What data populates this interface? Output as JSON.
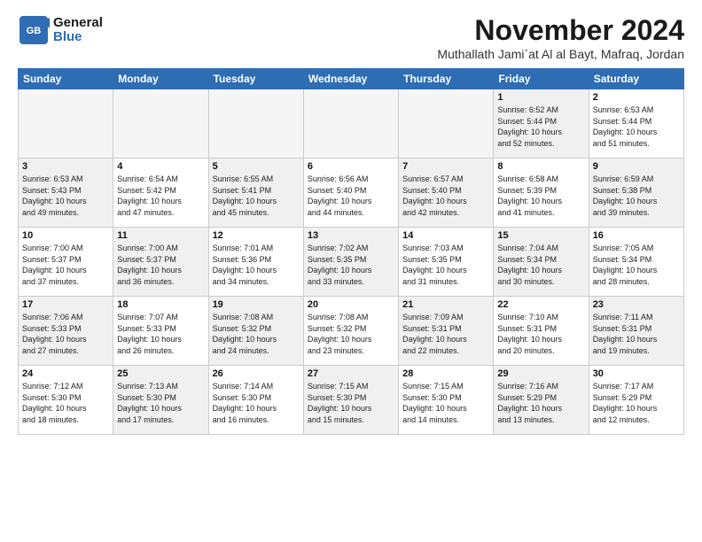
{
  "header": {
    "logo_line1": "General",
    "logo_line2": "Blue",
    "month": "November 2024",
    "location": "Muthallath Jami`at Al al Bayt, Mafraq, Jordan"
  },
  "days_of_week": [
    "Sunday",
    "Monday",
    "Tuesday",
    "Wednesday",
    "Thursday",
    "Friday",
    "Saturday"
  ],
  "weeks": [
    [
      {
        "day": "",
        "info": "",
        "empty": true
      },
      {
        "day": "",
        "info": "",
        "empty": true
      },
      {
        "day": "",
        "info": "",
        "empty": true
      },
      {
        "day": "",
        "info": "",
        "empty": true
      },
      {
        "day": "",
        "info": "",
        "empty": true
      },
      {
        "day": "1",
        "info": "Sunrise: 6:52 AM\nSunset: 5:44 PM\nDaylight: 10 hours\nand 52 minutes.",
        "shaded": true
      },
      {
        "day": "2",
        "info": "Sunrise: 6:53 AM\nSunset: 5:44 PM\nDaylight: 10 hours\nand 51 minutes.",
        "shaded": false
      }
    ],
    [
      {
        "day": "3",
        "info": "Sunrise: 6:53 AM\nSunset: 5:43 PM\nDaylight: 10 hours\nand 49 minutes.",
        "shaded": true
      },
      {
        "day": "4",
        "info": "Sunrise: 6:54 AM\nSunset: 5:42 PM\nDaylight: 10 hours\nand 47 minutes.",
        "shaded": false
      },
      {
        "day": "5",
        "info": "Sunrise: 6:55 AM\nSunset: 5:41 PM\nDaylight: 10 hours\nand 45 minutes.",
        "shaded": true
      },
      {
        "day": "6",
        "info": "Sunrise: 6:56 AM\nSunset: 5:40 PM\nDaylight: 10 hours\nand 44 minutes.",
        "shaded": false
      },
      {
        "day": "7",
        "info": "Sunrise: 6:57 AM\nSunset: 5:40 PM\nDaylight: 10 hours\nand 42 minutes.",
        "shaded": true
      },
      {
        "day": "8",
        "info": "Sunrise: 6:58 AM\nSunset: 5:39 PM\nDaylight: 10 hours\nand 41 minutes.",
        "shaded": false
      },
      {
        "day": "9",
        "info": "Sunrise: 6:59 AM\nSunset: 5:38 PM\nDaylight: 10 hours\nand 39 minutes.",
        "shaded": true
      }
    ],
    [
      {
        "day": "10",
        "info": "Sunrise: 7:00 AM\nSunset: 5:37 PM\nDaylight: 10 hours\nand 37 minutes.",
        "shaded": false
      },
      {
        "day": "11",
        "info": "Sunrise: 7:00 AM\nSunset: 5:37 PM\nDaylight: 10 hours\nand 36 minutes.",
        "shaded": true
      },
      {
        "day": "12",
        "info": "Sunrise: 7:01 AM\nSunset: 5:36 PM\nDaylight: 10 hours\nand 34 minutes.",
        "shaded": false
      },
      {
        "day": "13",
        "info": "Sunrise: 7:02 AM\nSunset: 5:35 PM\nDaylight: 10 hours\nand 33 minutes.",
        "shaded": true
      },
      {
        "day": "14",
        "info": "Sunrise: 7:03 AM\nSunset: 5:35 PM\nDaylight: 10 hours\nand 31 minutes.",
        "shaded": false
      },
      {
        "day": "15",
        "info": "Sunrise: 7:04 AM\nSunset: 5:34 PM\nDaylight: 10 hours\nand 30 minutes.",
        "shaded": true
      },
      {
        "day": "16",
        "info": "Sunrise: 7:05 AM\nSunset: 5:34 PM\nDaylight: 10 hours\nand 28 minutes.",
        "shaded": false
      }
    ],
    [
      {
        "day": "17",
        "info": "Sunrise: 7:06 AM\nSunset: 5:33 PM\nDaylight: 10 hours\nand 27 minutes.",
        "shaded": true
      },
      {
        "day": "18",
        "info": "Sunrise: 7:07 AM\nSunset: 5:33 PM\nDaylight: 10 hours\nand 26 minutes.",
        "shaded": false
      },
      {
        "day": "19",
        "info": "Sunrise: 7:08 AM\nSunset: 5:32 PM\nDaylight: 10 hours\nand 24 minutes.",
        "shaded": true
      },
      {
        "day": "20",
        "info": "Sunrise: 7:08 AM\nSunset: 5:32 PM\nDaylight: 10 hours\nand 23 minutes.",
        "shaded": false
      },
      {
        "day": "21",
        "info": "Sunrise: 7:09 AM\nSunset: 5:31 PM\nDaylight: 10 hours\nand 22 minutes.",
        "shaded": true
      },
      {
        "day": "22",
        "info": "Sunrise: 7:10 AM\nSunset: 5:31 PM\nDaylight: 10 hours\nand 20 minutes.",
        "shaded": false
      },
      {
        "day": "23",
        "info": "Sunrise: 7:11 AM\nSunset: 5:31 PM\nDaylight: 10 hours\nand 19 minutes.",
        "shaded": true
      }
    ],
    [
      {
        "day": "24",
        "info": "Sunrise: 7:12 AM\nSunset: 5:30 PM\nDaylight: 10 hours\nand 18 minutes.",
        "shaded": false
      },
      {
        "day": "25",
        "info": "Sunrise: 7:13 AM\nSunset: 5:30 PM\nDaylight: 10 hours\nand 17 minutes.",
        "shaded": true
      },
      {
        "day": "26",
        "info": "Sunrise: 7:14 AM\nSunset: 5:30 PM\nDaylight: 10 hours\nand 16 minutes.",
        "shaded": false
      },
      {
        "day": "27",
        "info": "Sunrise: 7:15 AM\nSunset: 5:30 PM\nDaylight: 10 hours\nand 15 minutes.",
        "shaded": true
      },
      {
        "day": "28",
        "info": "Sunrise: 7:15 AM\nSunset: 5:30 PM\nDaylight: 10 hours\nand 14 minutes.",
        "shaded": false
      },
      {
        "day": "29",
        "info": "Sunrise: 7:16 AM\nSunset: 5:29 PM\nDaylight: 10 hours\nand 13 minutes.",
        "shaded": true
      },
      {
        "day": "30",
        "info": "Sunrise: 7:17 AM\nSunset: 5:29 PM\nDaylight: 10 hours\nand 12 minutes.",
        "shaded": false
      }
    ]
  ]
}
